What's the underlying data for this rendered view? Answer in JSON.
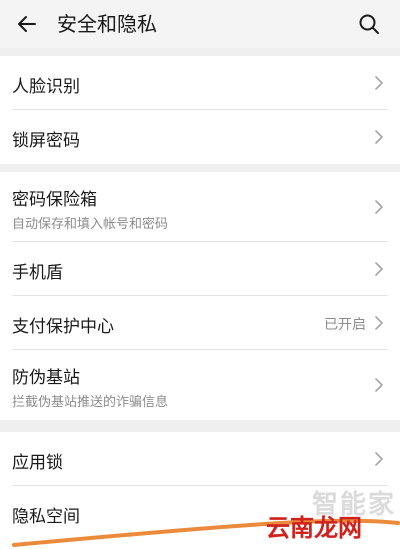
{
  "header": {
    "back_icon": "arrow-left-icon",
    "title": "安全和隐私",
    "search_icon": "search-icon"
  },
  "groups": [
    {
      "rows": [
        {
          "label": "人脸识别"
        },
        {
          "label": "锁屏密码"
        }
      ]
    },
    {
      "rows": [
        {
          "label": "密码保险箱",
          "sublabel": "自动保存和填入帐号和密码"
        },
        {
          "label": "手机盾"
        },
        {
          "label": "支付保护中心",
          "status": "已开启"
        },
        {
          "label": "防伪基站",
          "sublabel": "拦截伪基站推送的诈骗信息"
        }
      ]
    },
    {
      "rows": [
        {
          "label": "应用锁"
        },
        {
          "label": "隐私空间"
        }
      ]
    }
  ],
  "watermark": {
    "primary": "云南龙网",
    "secondary": "智能家"
  },
  "colors": {
    "background": "#efefef",
    "surface": "#ffffff",
    "text_primary": "#1a1a1a",
    "text_secondary": "#8c8c8c",
    "divider": "#e4e4e4",
    "watermark_red": "#d0211c",
    "stroke_orange": "#ec8a3c"
  }
}
